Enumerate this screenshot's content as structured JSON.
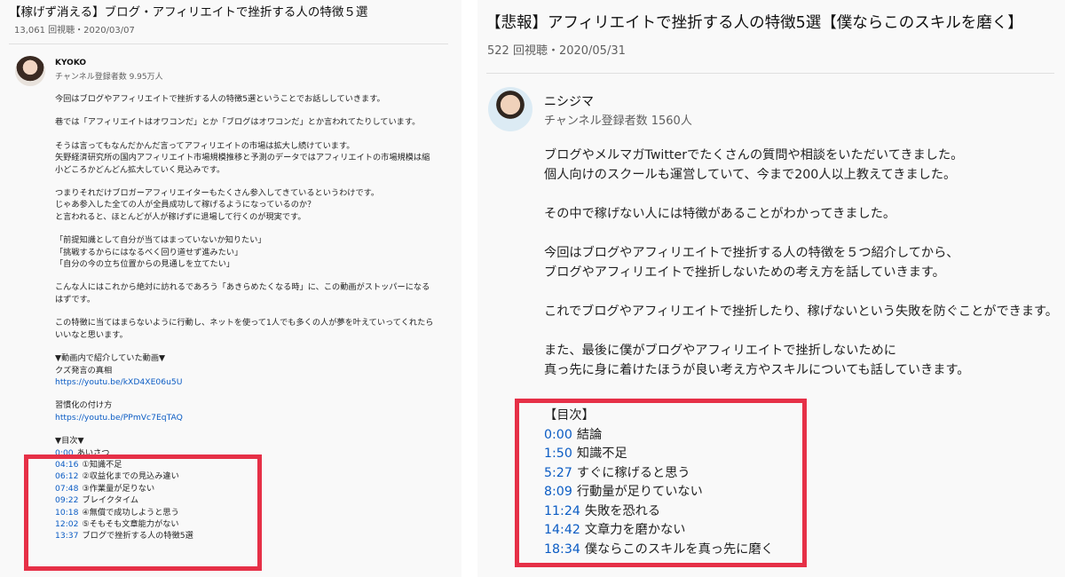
{
  "left": {
    "title": "【稼げず消える】ブログ・アフィリエイトで挫折する人の特徴５選",
    "meta": "13,061 回視聴・2020/03/07",
    "channel_name": "KYOKO",
    "subscribers": "チャンネル登録者数 9.95万人",
    "paragraphs": [
      "今回はブログやアフィリエイトで挫折する人の特徴5選ということでお話ししていきます。",
      "巷では「アフィリエイトはオワコンだ」とか「ブログはオワコンだ」とか言われてたりしています。",
      "そうは言ってもなんだかんだ言ってアフィリエイトの市場は拡大し続けています。\n矢野経済研究所の国内アフィリエイト市場規模推移と予測のデータではアフィリエイトの市場規模は縮小どころかどんどん拡大していく見込みです。",
      "つまりそれだけブロガーアフィリエイターもたくさん参入してきているというわけです。\nじゃあ参入した全ての人が全員成功して稼げるようになっているのか？\nと言われると、ほとんどが人が稼げずに退場して行くのが現実です。",
      "「前提知識として自分が当てはまっていないか知りたい」\n「挑戦するからにはなるべく回り道せず進みたい」\n「自分の今の立ち位置からの見通しを立てたい」",
      "こんな人にはこれから絶対に訪れるであろう「あきらめたくなる時」に、この動画がストッパーになるはずです。",
      "この特徴に当てはまらないように行動し、ネットを使って1人でも多くの人が夢を叶えていってくれたらいいなと思います。"
    ],
    "links_header": "▼動画内で紹介していた動画▼",
    "link1_label": "クズ発言の真相",
    "link1_url": "https://youtu.be/kXD4XE06u5U",
    "link2_label": "習慣化の付け方",
    "link2_url": "https://youtu.be/PPmVc7EqTAQ",
    "toc_header": "▼目次▼",
    "toc": [
      {
        "time": "0:00",
        "label": "あいさつ"
      },
      {
        "time": "04:16",
        "label": "①知識不足"
      },
      {
        "time": "06:12",
        "label": "②収益化までの見込み違い"
      },
      {
        "time": "07:48",
        "label": "③作業量が足りない"
      },
      {
        "time": "09:22",
        "label": "ブレイクタイム"
      },
      {
        "time": "10:18",
        "label": "④無償で成功しようと思う"
      },
      {
        "time": "12:02",
        "label": "⑤そもそも文章能力がない"
      },
      {
        "time": "13:37",
        "label": "ブログで挫折する人の特徴5選"
      }
    ]
  },
  "right": {
    "title": "【悲報】アフィリエイトで挫折する人の特徴5選【僕ならこのスキルを磨く】",
    "meta": "522 回視聴・2020/05/31",
    "channel_name": "ニシジマ",
    "subscribers": "チャンネル登録者数 1560人",
    "paragraphs": [
      "ブログやメルマガTwitterでたくさんの質問や相談をいただいてきました。\n個人向けのスクールも運営していて、今まで200人以上教えてきました。",
      "その中で稼げない人には特徴があることがわかってきました。",
      "今回はブログやアフィリエイトで挫折する人の特徴を５つ紹介してから、\nブログやアフィリエイトで挫折しないための考え方を話していきます。",
      "これでブログやアフィリエイトで挫折したり、稼げないという失敗を防ぐことができます。",
      "また、最後に僕がブログやアフィリエイトで挫折しないために\n真っ先に身に着けたほうが良い考え方やスキルについても話していきます。"
    ],
    "toc_header": "【目次】",
    "toc": [
      {
        "time": "0:00",
        "label": "結論"
      },
      {
        "time": "1:50",
        "label": "知識不足"
      },
      {
        "time": "5:27",
        "label": "すぐに稼げると思う"
      },
      {
        "time": "8:09",
        "label": "行動量が足りていない"
      },
      {
        "time": "11:24",
        "label": "失敗を恐れる"
      },
      {
        "time": "14:42",
        "label": "文章力を磨かない"
      },
      {
        "time": "18:34",
        "label": "僕ならこのスキルを真っ先に磨く"
      }
    ]
  },
  "colors": {
    "link": "#0b5cc4",
    "highlight_border": "#e63047",
    "meta_text": "#606060"
  }
}
